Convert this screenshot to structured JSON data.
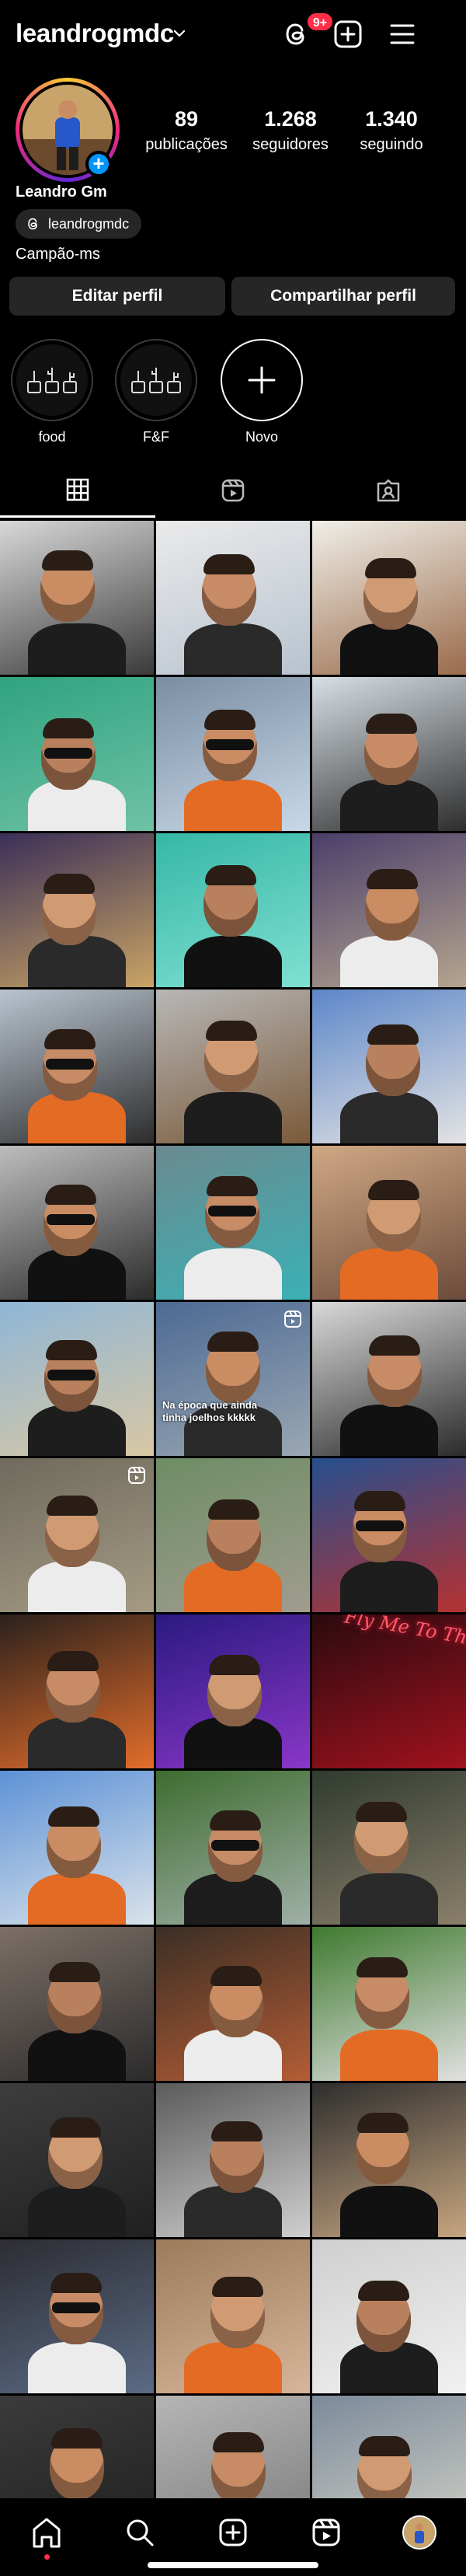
{
  "header": {
    "username": "leandrogmdc",
    "notifications_badge": "9+"
  },
  "profile": {
    "name": "Leandro Gm",
    "threads_handle": "leandrogmdc",
    "location": "Campão-ms",
    "stats": [
      {
        "value": "89",
        "label": "publicações"
      },
      {
        "value": "1.268",
        "label": "seguidores"
      },
      {
        "value": "1.340",
        "label": "seguindo"
      }
    ]
  },
  "buttons": {
    "edit": "Editar perfil",
    "share": "Compartilhar perfil"
  },
  "highlights": [
    {
      "label": "food"
    },
    {
      "label": "F&F"
    },
    {
      "label": "Novo"
    }
  ],
  "tabs": [
    {
      "name": "grid-icon",
      "active": true
    },
    {
      "name": "reels-icon",
      "active": false
    },
    {
      "name": "tagged-icon",
      "active": false
    }
  ],
  "posts": [
    {
      "type": "photo"
    },
    {
      "type": "photo"
    },
    {
      "type": "photo"
    },
    {
      "type": "photo"
    },
    {
      "type": "photo"
    },
    {
      "type": "photo"
    },
    {
      "type": "photo"
    },
    {
      "type": "photo"
    },
    {
      "type": "photo"
    },
    {
      "type": "photo"
    },
    {
      "type": "photo"
    },
    {
      "type": "photo"
    },
    {
      "type": "photo"
    },
    {
      "type": "photo"
    },
    {
      "type": "photo"
    },
    {
      "type": "photo"
    },
    {
      "type": "reel",
      "caption": "Na época que ainda tinha joelhos kkkkk"
    },
    {
      "type": "photo"
    },
    {
      "type": "reel"
    },
    {
      "type": "photo"
    },
    {
      "type": "photo"
    },
    {
      "type": "photo"
    },
    {
      "type": "photo"
    },
    {
      "type": "photo",
      "neon_text": "Fly Me To The Moon"
    },
    {
      "type": "photo"
    },
    {
      "type": "photo"
    },
    {
      "type": "photo"
    },
    {
      "type": "photo"
    },
    {
      "type": "photo"
    },
    {
      "type": "photo"
    },
    {
      "type": "photo"
    },
    {
      "type": "photo"
    },
    {
      "type": "photo"
    },
    {
      "type": "photo"
    },
    {
      "type": "photo"
    },
    {
      "type": "photo"
    },
    {
      "type": "photo"
    },
    {
      "type": "photo"
    },
    {
      "type": "photo"
    }
  ],
  "bottom_nav": [
    {
      "name": "home-icon"
    },
    {
      "name": "search-icon"
    },
    {
      "name": "create-icon"
    },
    {
      "name": "reels-icon"
    },
    {
      "name": "profile-avatar"
    }
  ]
}
